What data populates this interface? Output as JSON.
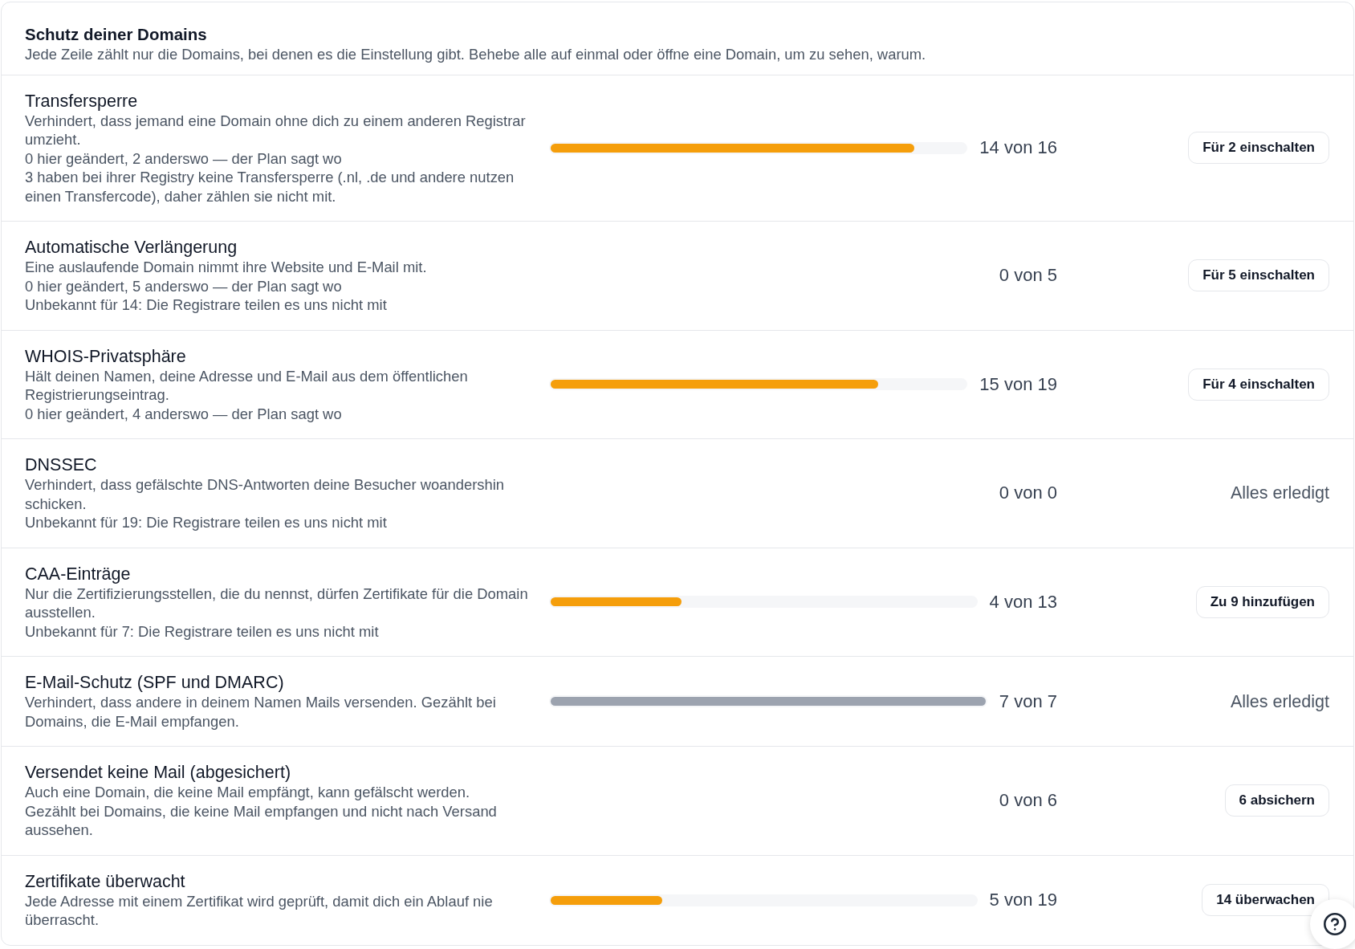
{
  "card": {
    "title": "Schutz deiner Domains",
    "subtitle": "Jede Zeile zählt nur die Domains, bei denen es die Einstellung gibt. Behebe alle auf einmal oder öffne eine Domain, um zu sehen, warum."
  },
  "rows": [
    {
      "title": "Transfersperre",
      "lines": [
        "Verhindert, dass jemand eine Domain ohne dich zu einem anderen Registrar umzieht.",
        "0 hier geändert, 2 anderswo — der Plan sagt wo",
        "3 haben bei ihrer Registry keine Transfersperre (.nl, .de und andere nutzen einen Transfercode), daher zählen sie nicht mit."
      ],
      "bar": {
        "level": 0.875,
        "color": "#f59e0b"
      },
      "count": "14 von 16",
      "action": {
        "kind": "button",
        "label": "Für 2 einschalten"
      }
    },
    {
      "title": "Automatische Verlängerung",
      "lines": [
        "Eine auslaufende Domain nimmt ihre Website und E-Mail mit.",
        "0 hier geändert, 5 anderswo — der Plan sagt wo",
        "Unbekannt für 14: Die Registrare teilen es uns nicht mit"
      ],
      "count": "0 von 5",
      "action": {
        "kind": "button",
        "label": "Für 5 einschalten"
      }
    },
    {
      "title": "WHOIS-Privatsphäre",
      "lines": [
        "Hält deinen Namen, deine Adresse und E-Mail aus dem öffentlichen Registrierungseintrag.",
        "0 hier geändert, 4 anderswo — der Plan sagt wo"
      ],
      "bar": {
        "level": 0.789,
        "color": "#f59e0b"
      },
      "count": "15 von 19",
      "action": {
        "kind": "button",
        "label": "Für 4 einschalten"
      }
    },
    {
      "title": "DNSSEC",
      "lines": [
        "Verhindert, dass gefälschte DNS-Antworten deine Besucher woandershin schicken.",
        "Unbekannt für 19: Die Registrare teilen es uns nicht mit"
      ],
      "count": "0 von 0",
      "action": {
        "kind": "status",
        "label": "Alles erledigt"
      }
    },
    {
      "title": "CAA-Einträge",
      "lines": [
        "Nur die Zertifizierungsstellen, die du nennst, dürfen Zertifikate für die Domain ausstellen.",
        "Unbekannt für 7: Die Registrare teilen es uns nicht mit"
      ],
      "bar": {
        "level": 0.308,
        "color": "#f59e0b"
      },
      "count": "4 von 13",
      "action": {
        "kind": "button",
        "label": "Zu 9 hinzufügen"
      }
    },
    {
      "title": "E-Mail-Schutz (SPF und DMARC)",
      "lines": [
        "Verhindert, dass andere in deinem Namen Mails versenden. Gezählt bei Domains, die E-Mail empfangen."
      ],
      "bar": {
        "level": 1,
        "color": "#9ca3af"
      },
      "count": "7 von 7",
      "action": {
        "kind": "status",
        "label": "Alles erledigt"
      }
    },
    {
      "title": "Versendet keine Mail (abgesichert)",
      "lines": [
        "Auch eine Domain, die keine Mail empfängt, kann gefälscht werden.",
        "Gezählt bei Domains, die keine Mail empfangen und nicht nach Versand aussehen."
      ],
      "count": "0 von 6",
      "action": {
        "kind": "button",
        "label": "6 absichern"
      }
    },
    {
      "title": "Zertifikate überwacht",
      "lines": [
        "Jede Adresse mit einem Zertifikat wird geprüft, damit dich ein Ablauf nie überrascht."
      ],
      "bar": {
        "level": 0.263,
        "color": "#f59e0b"
      },
      "count": "5 von 19",
      "action": {
        "kind": "button",
        "label": "14 überwachen"
      }
    }
  ]
}
